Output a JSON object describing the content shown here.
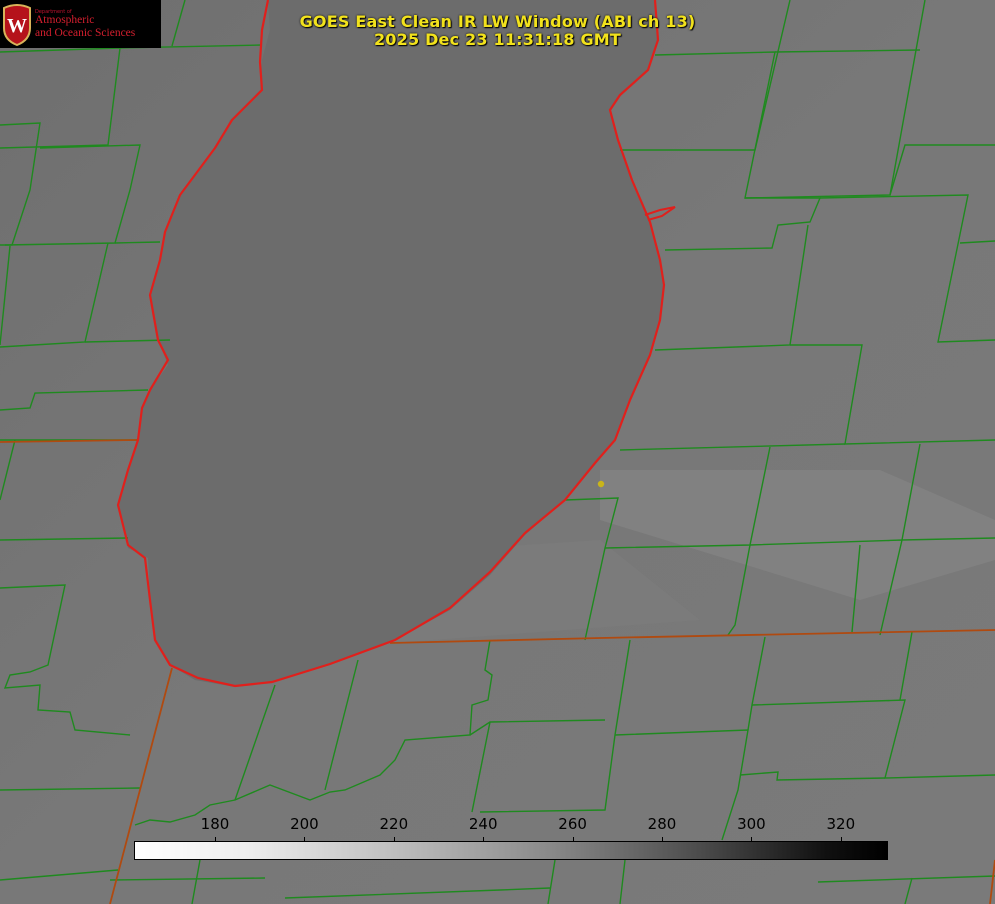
{
  "title": {
    "line1": "GOES East Clean IR LW Window (ABI ch 13)",
    "line2": "2025 Dec 23 11:31:18 GMT"
  },
  "logo": {
    "department": "Department of",
    "line1": "Atmospheric",
    "line2": "and Oceanic Sciences",
    "crest_letter": "W"
  },
  "colorbar": {
    "ticks": [
      "180",
      "200",
      "220",
      "240",
      "260",
      "280",
      "300",
      "320"
    ],
    "gradient": "white-to-black"
  },
  "colors": {
    "title_text": "#f2e21c",
    "county_lines": "#1f8a1f",
    "lake_outline": "#e0201c",
    "state_lines": "#b04a10",
    "marker": "#c9b51a",
    "logo_red": "#c1122f"
  },
  "map": {
    "feature": "lake outline with county boundaries",
    "marker": "station-dot"
  }
}
